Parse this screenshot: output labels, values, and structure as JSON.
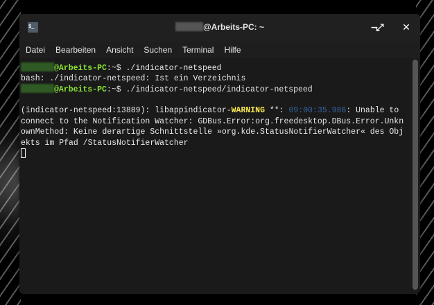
{
  "window": {
    "title_suffix": "@Arbeits-PC: ~",
    "app_icon": "terminal-icon",
    "buttons": {
      "minimize": "−",
      "maximize": "⤢",
      "close": "✕"
    }
  },
  "menu": [
    "Datei",
    "Bearbeiten",
    "Ansicht",
    "Suchen",
    "Terminal",
    "Hilfe"
  ],
  "terminal": {
    "prompt_host": "@Arbeits-PC",
    "prompt_path": ":~$ ",
    "cmd1": "./indicator-netspeed",
    "out1": "bash: ./indicator-netspeed: Ist ein Verzeichnis",
    "cmd2": "./indicator-netspeed/indicator-netspeed",
    "warn_prefix": "(indicator-netspeed:13889): libappindicator-",
    "warn_label": "WARNING",
    "warn_mid": " **: ",
    "timestamp": "09:00:35.986",
    "warn_rest1": ": Unable to",
    "warn_line2": "connect to the Notification Watcher: GDBus.Error:org.freedesktop.DBus.Error.Unkn",
    "warn_line3": "ownMethod: Keine derartige Schnittstelle »org.kde.StatusNotifierWatcher« des Obj",
    "warn_line4": "ekts im Pfad /StatusNotifierWatcher"
  }
}
